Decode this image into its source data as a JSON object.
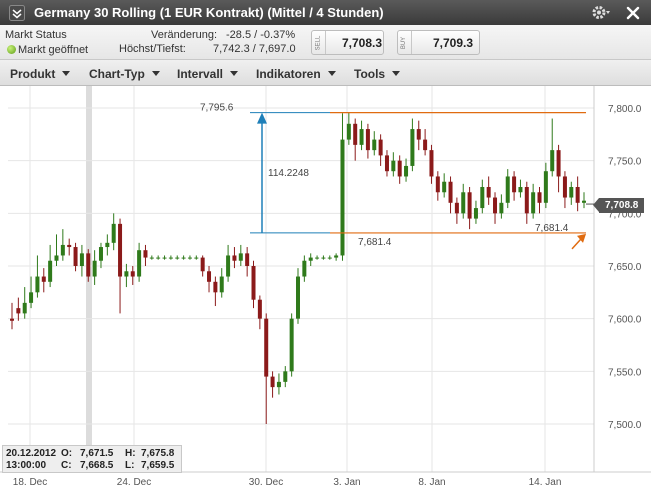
{
  "window": {
    "title": "Germany 30 Rolling (1 EUR Kontrakt) (Mittel / 4 Stunden)"
  },
  "status": {
    "market_status_label": "Markt Status",
    "market_open_label": "Markt geöffnet",
    "change_label": "Veränderung:",
    "change_value": "-28.5 / -0.37%",
    "high_low_label": "Höchst/Tiefst:",
    "high_low_value": "7,742.3 / 7,697.0",
    "sell_label": "SELL",
    "sell_value": "7,708.3",
    "buy_label": "BUY",
    "buy_value": "7,709.3"
  },
  "menu": {
    "items": [
      "Produkt",
      "Chart-Typ",
      "Intervall",
      "Indikatoren",
      "Tools"
    ]
  },
  "colors": {
    "up": "#2f7a1b",
    "down": "#8b1a1a",
    "annotation_blue": "#1e7fb8",
    "annotation_orange": "#e06b10"
  },
  "chart_data": {
    "type": "candlestick",
    "y_ticks": [
      "7,800.0",
      "7,750.0",
      "7,700.0",
      "7,650.0",
      "7,600.0",
      "7,550.0",
      "7,500.0"
    ],
    "ylim": [
      7480,
      7820
    ],
    "x_ticks": [
      "18. Dec",
      "24. Dec",
      "30. Dec",
      "3. Jan",
      "8. Jan",
      "14. Jan"
    ],
    "current_price_label": "7,708.8",
    "current_price": 7708.8,
    "annotations": {
      "high_label": "7,795.6",
      "high_value": 7795.6,
      "low_value": 7681.4,
      "range_label": "114.2248",
      "low_label_1": "7,681.4",
      "low_label_2": "7,681.4"
    },
    "crosshair_info": {
      "date": "20.12.2012",
      "time": "13:00:00",
      "open_label": "O:",
      "open": "7,671.5",
      "close_label": "C:",
      "close": "7,668.5",
      "high_label": "H:",
      "high": "7,675.8",
      "low_label": "L:",
      "low": "7,659.5"
    },
    "candles": [
      [
        7600,
        7598,
        7615,
        7590
      ],
      [
        7610,
        7605,
        7620,
        7598
      ],
      [
        7605,
        7615,
        7630,
        7600
      ],
      [
        7615,
        7625,
        7640,
        7610
      ],
      [
        7625,
        7640,
        7660,
        7620
      ],
      [
        7640,
        7635,
        7648,
        7625
      ],
      [
        7635,
        7655,
        7670,
        7630
      ],
      [
        7655,
        7660,
        7680,
        7650
      ],
      [
        7660,
        7670,
        7685,
        7655
      ],
      [
        7670,
        7668,
        7676,
        7660
      ],
      [
        7668,
        7650,
        7672,
        7645
      ],
      [
        7650,
        7662,
        7670,
        7640
      ],
      [
        7662,
        7640,
        7666,
        7635
      ],
      [
        7640,
        7655,
        7665,
        7632
      ],
      [
        7655,
        7668,
        7672,
        7648
      ],
      [
        7668,
        7672,
        7680,
        7660
      ],
      [
        7672,
        7690,
        7700,
        7665
      ],
      [
        7690,
        7640,
        7695,
        7605
      ],
      [
        7640,
        7645,
        7652,
        7630
      ],
      [
        7645,
        7640,
        7650,
        7632
      ],
      [
        7640,
        7665,
        7672,
        7635
      ],
      [
        7665,
        7658,
        7670,
        7650
      ],
      [
        7658,
        7658,
        7660,
        7656
      ],
      [
        7658,
        7658,
        7660,
        7656
      ],
      [
        7658,
        7658,
        7660,
        7656
      ],
      [
        7658,
        7658,
        7660,
        7656
      ],
      [
        7658,
        7658,
        7660,
        7656
      ],
      [
        7658,
        7658,
        7660,
        7656
      ],
      [
        7658,
        7658,
        7660,
        7656
      ],
      [
        7658,
        7658,
        7660,
        7656
      ],
      [
        7658,
        7645,
        7660,
        7640
      ],
      [
        7645,
        7635,
        7650,
        7625
      ],
      [
        7635,
        7625,
        7640,
        7612
      ],
      [
        7625,
        7640,
        7648,
        7620
      ],
      [
        7640,
        7660,
        7670,
        7635
      ],
      [
        7660,
        7655,
        7668,
        7648
      ],
      [
        7655,
        7662,
        7670,
        7650
      ],
      [
        7662,
        7650,
        7668,
        7640
      ],
      [
        7650,
        7618,
        7655,
        7610
      ],
      [
        7618,
        7600,
        7622,
        7590
      ],
      [
        7600,
        7545,
        7605,
        7500
      ],
      [
        7545,
        7535,
        7550,
        7525
      ],
      [
        7535,
        7540,
        7548,
        7528
      ],
      [
        7540,
        7550,
        7555,
        7535
      ],
      [
        7550,
        7600,
        7605,
        7545
      ],
      [
        7600,
        7640,
        7648,
        7595
      ],
      [
        7640,
        7655,
        7660,
        7635
      ],
      [
        7655,
        7658,
        7662,
        7650
      ],
      [
        7658,
        7658,
        7660,
        7656
      ],
      [
        7658,
        7658,
        7660,
        7656
      ],
      [
        7658,
        7658,
        7660,
        7656
      ],
      [
        7658,
        7660,
        7662,
        7655
      ],
      [
        7660,
        7770,
        7795,
        7655
      ],
      [
        7770,
        7785,
        7796,
        7765
      ],
      [
        7785,
        7765,
        7790,
        7750
      ],
      [
        7765,
        7780,
        7788,
        7760
      ],
      [
        7780,
        7760,
        7785,
        7752
      ],
      [
        7760,
        7770,
        7778,
        7755
      ],
      [
        7770,
        7755,
        7775,
        7745
      ],
      [
        7755,
        7740,
        7760,
        7735
      ],
      [
        7740,
        7750,
        7758,
        7735
      ],
      [
        7750,
        7735,
        7755,
        7728
      ],
      [
        7735,
        7745,
        7752,
        7730
      ],
      [
        7745,
        7780,
        7790,
        7740
      ],
      [
        7780,
        7770,
        7788,
        7760
      ],
      [
        7770,
        7760,
        7780,
        7755
      ],
      [
        7760,
        7735,
        7765,
        7728
      ],
      [
        7735,
        7720,
        7740,
        7712
      ],
      [
        7720,
        7730,
        7738,
        7715
      ],
      [
        7730,
        7710,
        7735,
        7700
      ],
      [
        7710,
        7700,
        7715,
        7690
      ],
      [
        7700,
        7720,
        7728,
        7695
      ],
      [
        7720,
        7695,
        7725,
        7685
      ],
      [
        7695,
        7705,
        7712,
        7690
      ],
      [
        7705,
        7725,
        7732,
        7700
      ],
      [
        7725,
        7715,
        7735,
        7708
      ],
      [
        7715,
        7700,
        7720,
        7690
      ],
      [
        7700,
        7710,
        7718,
        7695
      ],
      [
        7710,
        7735,
        7742,
        7705
      ],
      [
        7735,
        7720,
        7740,
        7712
      ],
      [
        7720,
        7725,
        7732,
        7715
      ],
      [
        7725,
        7700,
        7730,
        7690
      ],
      [
        7700,
        7720,
        7728,
        7695
      ],
      [
        7720,
        7710,
        7725,
        7700
      ],
      [
        7710,
        7740,
        7748,
        7705
      ],
      [
        7740,
        7760,
        7790,
        7735
      ],
      [
        7760,
        7735,
        7765,
        7720
      ],
      [
        7735,
        7715,
        7740,
        7705
      ],
      [
        7715,
        7725,
        7730,
        7708
      ],
      [
        7725,
        7710,
        7735,
        7702
      ],
      [
        7710,
        7712,
        7720,
        7705
      ]
    ]
  }
}
